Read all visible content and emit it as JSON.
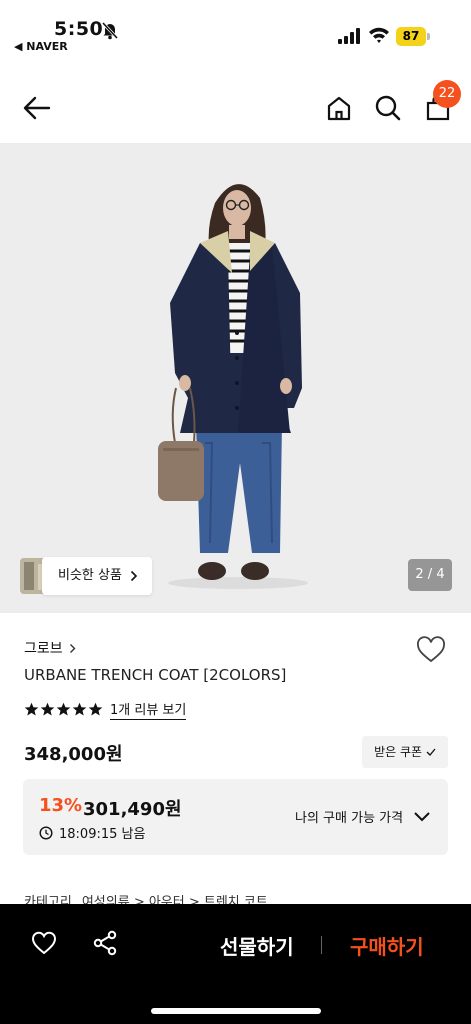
{
  "status": {
    "time": "5:50",
    "back_app": "◀ NAVER",
    "battery": "87"
  },
  "header": {
    "cart_count": "22"
  },
  "hero": {
    "similar_label": "비슷한 상품",
    "counter": "2 / 4"
  },
  "product": {
    "brand": "그로브",
    "title": "URBANE TRENCH COAT [2COLORS]",
    "rating_stars": 5,
    "review_link": "1개 리뷰 보기",
    "price": "348,000원",
    "coupon_button": "받은 쿠폰"
  },
  "discount": {
    "rate": "13%",
    "sale_price": "301,490원",
    "timer": "18:09:15 남음",
    "my_price_label": "나의 구매 가능 가격"
  },
  "category": {
    "label": "카테고리",
    "path": "여성의류 > 아우터 > 트렌치 코트"
  },
  "bottom": {
    "gift_label": "선물하기",
    "buy_label": "구매하기"
  },
  "colors": {
    "accent": "#f4511e",
    "bottom_bg": "#000000",
    "battery": "#f5d21a"
  },
  "icons": [
    "back-arrow-icon",
    "home-icon",
    "search-icon",
    "bag-icon",
    "heart-icon",
    "star-icon",
    "clock-icon",
    "chevron-down-icon",
    "share-icon"
  ]
}
